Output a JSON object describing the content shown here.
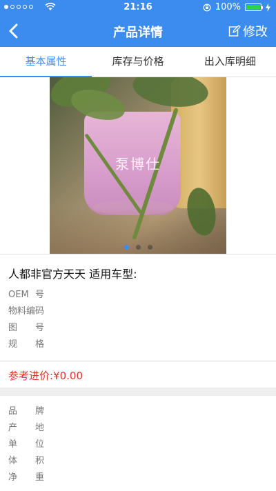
{
  "status_bar": {
    "time": "21:16",
    "battery": "100%",
    "battery_level": 1.0
  },
  "nav": {
    "title": "产品详情",
    "edit_label": "修改"
  },
  "tabs": [
    {
      "label": "基本属性",
      "active": true
    },
    {
      "label": "库存与价格",
      "active": false
    },
    {
      "label": "出入库明细",
      "active": false
    }
  ],
  "photo": {
    "watermark": "泵博仕",
    "page_count": 3,
    "current_page": 1
  },
  "product": {
    "name": "人都非官方天天 适用车型:"
  },
  "attributes": [
    {
      "label": "OEM号",
      "value": ""
    },
    {
      "label": "物料编码",
      "value": ""
    },
    {
      "label": "图号",
      "value": ""
    },
    {
      "label": "规格",
      "value": ""
    }
  ],
  "price": {
    "text": "参考进价:¥0.00"
  },
  "details": [
    {
      "label": "品牌",
      "value": ""
    },
    {
      "label": "产地",
      "value": ""
    },
    {
      "label": "单位",
      "value": ""
    },
    {
      "label": "体积",
      "value": ""
    },
    {
      "label": "净重",
      "value": ""
    }
  ],
  "colors": {
    "primary": "#3c8cf0",
    "price_red": "#e0322b",
    "battery_green": "#2fd14a"
  }
}
